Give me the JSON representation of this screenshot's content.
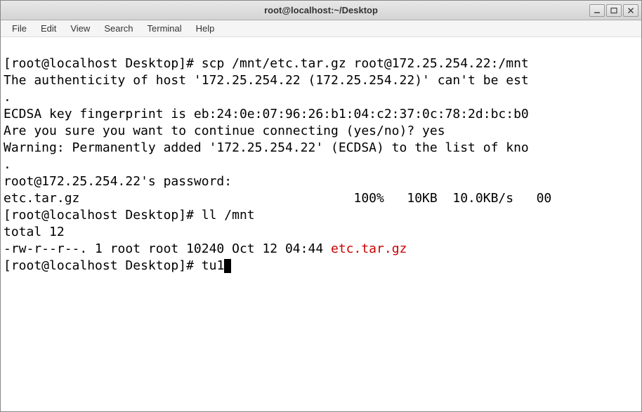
{
  "window": {
    "title": "root@localhost:~/Desktop"
  },
  "menu": {
    "file": "File",
    "edit": "Edit",
    "view": "View",
    "search": "Search",
    "terminal": "Terminal",
    "help": "Help"
  },
  "term": {
    "l1_prompt": "[root@localhost Desktop]# ",
    "l1_cmd": "scp /mnt/etc.tar.gz root@172.25.254.22:/mnt",
    "l2": "The authenticity of host '172.25.254.22 (172.25.254.22)' can't be est",
    "l3": ".",
    "l4": "ECDSA key fingerprint is eb:24:0e:07:96:26:b1:04:c2:37:0c:78:2d:bc:b0",
    "l5": "Are you sure you want to continue connecting (yes/no)? yes",
    "l6": "Warning: Permanently added '172.25.254.22' (ECDSA) to the list of kno",
    "l7": ".",
    "l8": "root@172.25.254.22's password: ",
    "l9": "etc.tar.gz                                    100%   10KB  10.0KB/s   00",
    "l10_prompt": "[root@localhost Desktop]# ",
    "l10_cmd": "ll /mnt",
    "l11": "total 12",
    "l12_pre": "-rw-r--r--. 1 root root 10240 Oct 12 04:44 ",
    "l12_file": "etc.tar.gz",
    "l13_prompt": "[root@localhost Desktop]# ",
    "l13_cmd": "tu1"
  }
}
